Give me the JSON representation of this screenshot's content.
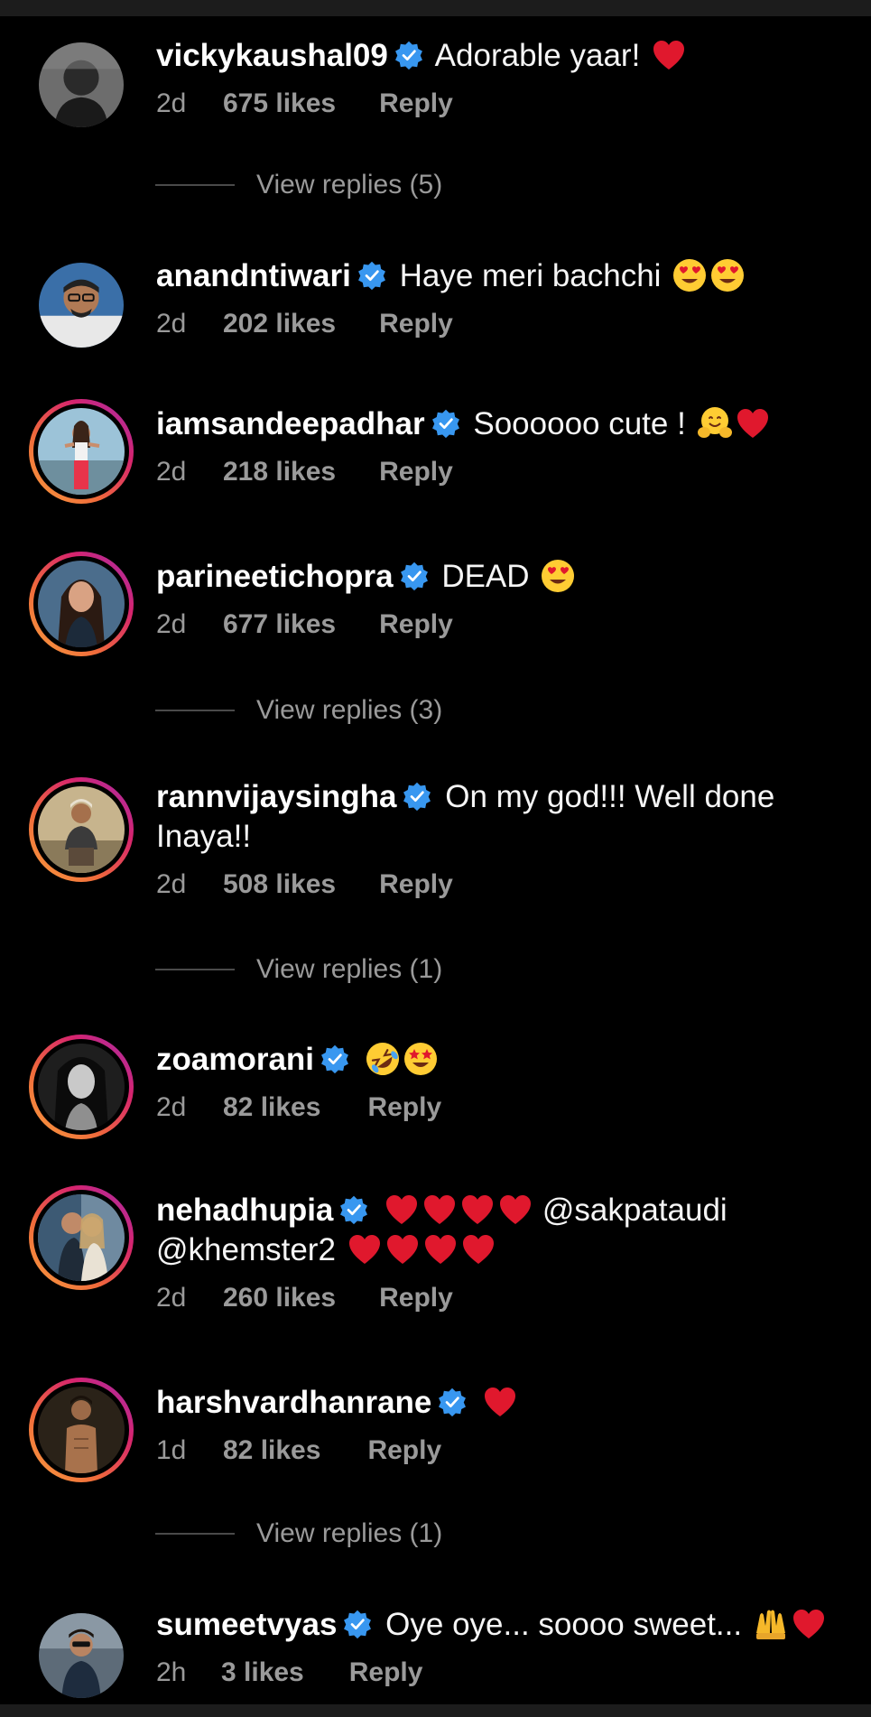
{
  "comments": [
    {
      "username": "vickykaushal09",
      "text": "Adorable yaar!",
      "emojis": [
        "heart"
      ],
      "age": "2d",
      "likes": "675 likes",
      "reply": "Reply",
      "view_replies": "View replies (5)"
    },
    {
      "username": "anandntiwari",
      "text": "Haye meri bachchi",
      "emojis": [
        "heart-eyes",
        "heart-eyes"
      ],
      "age": "2d",
      "likes": "202 likes",
      "reply": "Reply"
    },
    {
      "username": "iamsandeepadhar",
      "text": "Soooooo cute !",
      "emojis": [
        "hugging-face",
        "heart"
      ],
      "age": "2d",
      "likes": "218 likes",
      "reply": "Reply"
    },
    {
      "username": "parineetichopra",
      "text": "DEAD",
      "emojis": [
        "heart-eyes"
      ],
      "age": "2d",
      "likes": "677 likes",
      "reply": "Reply",
      "view_replies": "View replies (3)"
    },
    {
      "username": "rannvijaysingha",
      "text": "On my god!!! Well done Inaya!!",
      "emojis": [],
      "age": "2d",
      "likes": "508 likes",
      "reply": "Reply",
      "view_replies": "View replies (1)"
    },
    {
      "username": "zoamorani",
      "text": "",
      "emojis": [
        "rofl",
        "star-struck"
      ],
      "age": "2d",
      "likes": "82 likes",
      "reply": "Reply"
    },
    {
      "username": "nehadhupia",
      "text_parts": [
        "",
        "@sakpataudi @khemster2",
        ""
      ],
      "emojis_before": [
        "heart",
        "heart",
        "heart",
        "heart"
      ],
      "emojis_after": [
        "heart",
        "heart",
        "heart",
        "heart"
      ],
      "age": "2d",
      "likes": "260 likes",
      "reply": "Reply"
    },
    {
      "username": "harshvardhanrane",
      "text": "",
      "emojis": [
        "heart"
      ],
      "age": "1d",
      "likes": "82 likes",
      "reply": "Reply",
      "view_replies": "View replies (1)"
    },
    {
      "username": "sumeetvyas",
      "text": "Oye oye... soooo sweet...",
      "emojis": [
        "raising-hands",
        "heart"
      ],
      "age": "2h",
      "likes": "3 likes",
      "reply": "Reply"
    }
  ],
  "icons": {
    "verified": "verified-badge-icon",
    "heart": "red-heart-emoji",
    "heart-eyes": "heart-eyes-emoji",
    "hugging-face": "hugging-face-emoji",
    "rofl": "rolling-laughing-emoji",
    "star-struck": "star-struck-emoji",
    "raising-hands": "raising-hands-emoji"
  },
  "colors": {
    "background": "#000000",
    "meta_text": "#9a9a9a",
    "verified": "#3897f0",
    "heart": "#e0182d"
  }
}
